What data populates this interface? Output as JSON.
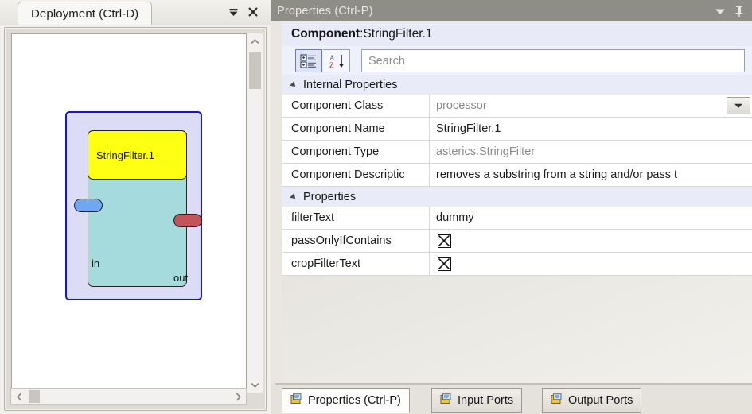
{
  "deployment": {
    "tab_label": "Deployment (Ctrl-D)",
    "minimize_icon": "collapse-icon",
    "close_icon": "close-icon",
    "component": {
      "title": "StringFilter.1",
      "input_port_label": "in",
      "output_port_label": "out",
      "title_color": "#ffff14",
      "body_color": "#a6dbdd",
      "selection_border_color": "#1414e6",
      "selection_fill_color": "#dcdcf7",
      "input_port_color": "#6fa8f0",
      "output_port_color": "#c2545a"
    },
    "scroll": {
      "up_icon": "chevron-up-icon",
      "down_icon": "chevron-down-icon",
      "left_icon": "chevron-left-icon",
      "right_icon": "chevron-right-icon"
    }
  },
  "properties": {
    "title": "Properties (Ctrl-P)",
    "dropdown_icon": "chevron-down-icon",
    "pin_icon": "pin-icon",
    "header": {
      "label": "Component",
      "separator": ": ",
      "value": "StringFilter.1"
    },
    "toolbar": {
      "categorized_button": "categorized-view-icon",
      "alphabetical_button": "sort-alphabetical-icon",
      "search_value": "",
      "search_placeholder": "Search"
    },
    "groups": [
      {
        "label": "Internal Properties",
        "rows": [
          {
            "key": "Component Class",
            "value": "processor",
            "muted": true,
            "control": "combo"
          },
          {
            "key": "Component Name",
            "value": "StringFilter.1",
            "muted": false,
            "control": "text"
          },
          {
            "key": "Component Type",
            "value": "asterics.StringFilter",
            "muted": true,
            "control": "text"
          },
          {
            "key": "Component Descriptic",
            "value": "removes a substring from a string and/or pass t",
            "muted": false,
            "control": "text"
          }
        ]
      },
      {
        "label": "Properties",
        "rows": [
          {
            "key": "filterText",
            "value": "dummy",
            "muted": false,
            "control": "text"
          },
          {
            "key": "passOnlyIfContains",
            "value": "",
            "muted": false,
            "control": "checkbox-x"
          },
          {
            "key": "cropFilterText",
            "value": "",
            "muted": false,
            "control": "checkbox-x"
          }
        ]
      }
    ],
    "bottom_tabs": [
      {
        "label": "Properties (Ctrl-P)",
        "icon": "document-icon",
        "active": true
      },
      {
        "label": "Input Ports",
        "icon": "document-icon",
        "active": false
      },
      {
        "label": "Output Ports",
        "icon": "document-icon",
        "active": false
      }
    ]
  }
}
